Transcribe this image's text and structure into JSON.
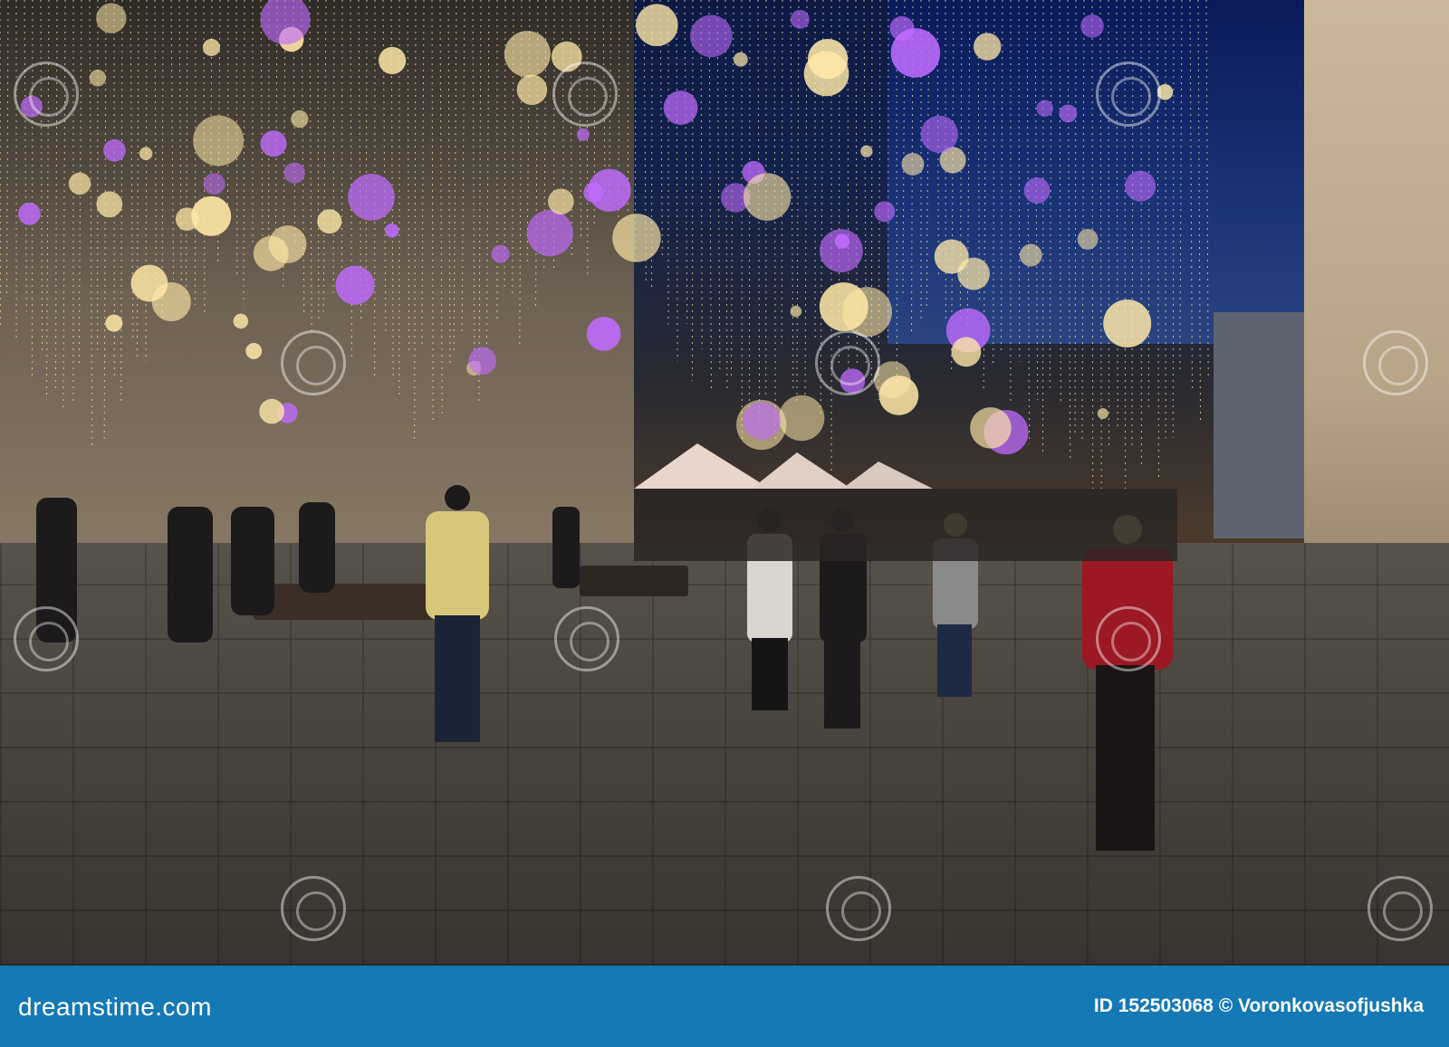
{
  "photo": {
    "description_subject": "",
    "accent_colors": {
      "lights": "#ffe9a8",
      "purple_orbs": "#c06bff",
      "sky": "#0d1a45"
    }
  },
  "watermark": {
    "repeated_text": "dreamstime"
  },
  "footer": {
    "brand": "dreamstime.com",
    "credit": "ID 152503068 © Voronkovasofjushka",
    "background_color": "#1479b5"
  }
}
